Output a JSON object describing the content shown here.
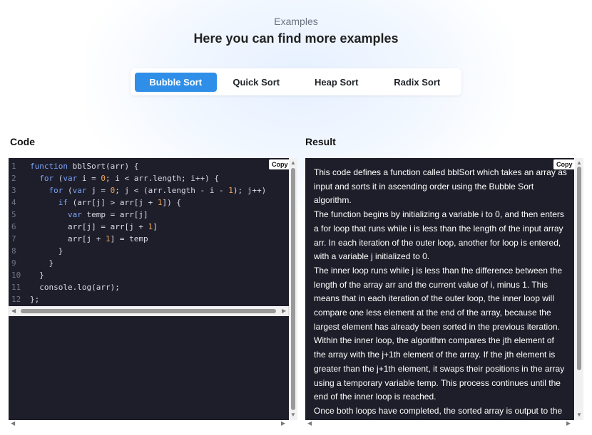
{
  "header": {
    "eyebrow": "Examples",
    "title": "Here you can find more examples"
  },
  "tabs": [
    {
      "label": "Bubble Sort",
      "active": true
    },
    {
      "label": "Quick Sort",
      "active": false
    },
    {
      "label": "Heap Sort",
      "active": false
    },
    {
      "label": "Radix Sort",
      "active": false
    }
  ],
  "code_section": {
    "label": "Code",
    "copy_label": "Copy",
    "lines": [
      {
        "num": "1",
        "text": "function bblSort(arr) {"
      },
      {
        "num": "2",
        "text": "  for (var i = 0; i < arr.length; i++) {"
      },
      {
        "num": "3",
        "text": "    for (var j = 0; j < (arr.length - i - 1); j++)"
      },
      {
        "num": "4",
        "text": "      if (arr[j] > arr[j + 1]) {"
      },
      {
        "num": "5",
        "text": "        var temp = arr[j]"
      },
      {
        "num": "6",
        "text": "        arr[j] = arr[j + 1]"
      },
      {
        "num": "7",
        "text": "        arr[j + 1] = temp"
      },
      {
        "num": "8",
        "text": "      }"
      },
      {
        "num": "9",
        "text": "    }"
      },
      {
        "num": "10",
        "text": "  }"
      },
      {
        "num": "11",
        "text": "  console.log(arr);"
      },
      {
        "num": "12",
        "text": "};"
      }
    ]
  },
  "result_section": {
    "label": "Result",
    "copy_label": "Copy",
    "paragraphs": [
      "This code defines a function called bblSort which takes an array as input and sorts it in ascending order using the Bubble Sort algorithm.",
      "The function begins by initializing a variable i to 0, and then enters a for loop that runs while i is less than the length of the input array arr. In each iteration of the outer loop, another for loop is entered, with a variable j initialized to 0.",
      "The inner loop runs while j is less than the difference between the length of the array arr and the current value of i, minus 1. This means that in each iteration of the outer loop, the inner loop will compare one less element at the end of the array, because the largest element has already been sorted in the previous iteration. Within the inner loop, the algorithm compares the jth element of the array with the j+1th element of the array. If the jth element is greater than the j+1th element, it swaps their positions in the array using a temporary variable temp. This process continues until the end of the inner loop is reached.",
      "Once both loops have completed, the sorted array is output to the"
    ]
  },
  "colors": {
    "accent": "#2f8fe8",
    "editor_bg": "#1e1e2a",
    "keyword": "#7aa2f7",
    "number": "#f2a65a"
  }
}
